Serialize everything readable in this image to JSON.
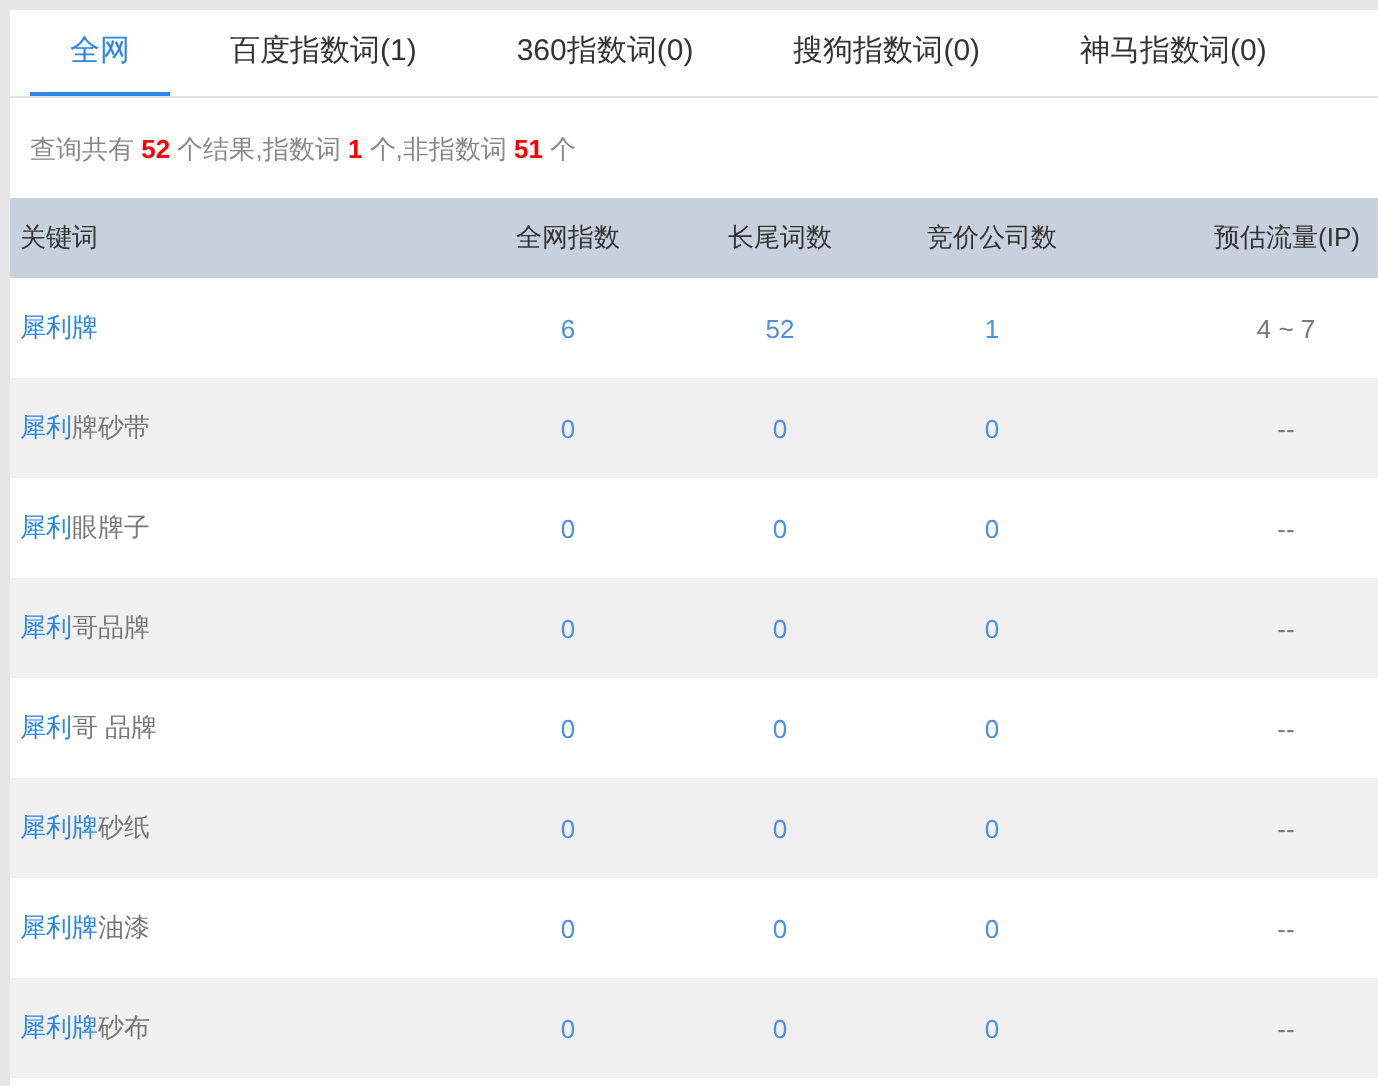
{
  "tabs": [
    {
      "label": "全网",
      "selected": true
    },
    {
      "label": "百度指数词(1)",
      "selected": false
    },
    {
      "label": "360指数词(0)",
      "selected": false
    },
    {
      "label": "搜狗指数词(0)",
      "selected": false
    },
    {
      "label": "神马指数词(0)",
      "selected": false
    }
  ],
  "summary": "查询共有 **52** 个结果,指数词 **1** 个,非指数词 **51** 个",
  "table": {
    "columns": [
      "关键词",
      "全网指数",
      "长尾词数",
      "竞价公司数",
      "预估流量(IP)"
    ],
    "rows": [
      {
        "keyword": {
          "match": "犀利牌"
        },
        "index": "6",
        "longtail": "52",
        "bidders": "1",
        "traffic": "4 ~ 7"
      },
      {
        "keyword": {
          "match": "犀利",
          "rest": "牌砂带"
        },
        "index": "0",
        "longtail": "0",
        "bidders": "0",
        "traffic": "--"
      },
      {
        "keyword": {
          "match": "犀利",
          "rest": "眼牌子"
        },
        "index": "0",
        "longtail": "0",
        "bidders": "0",
        "traffic": "--"
      },
      {
        "keyword": {
          "match": "犀利",
          "rest": "哥品牌"
        },
        "index": "0",
        "longtail": "0",
        "bidders": "0",
        "traffic": "--"
      },
      {
        "keyword": {
          "match": "犀利",
          "rest": "哥 品牌"
        },
        "index": "0",
        "longtail": "0",
        "bidders": "0",
        "traffic": "--"
      },
      {
        "keyword": {
          "match": "犀利牌",
          "rest": "砂纸"
        },
        "index": "0",
        "longtail": "0",
        "bidders": "0",
        "traffic": "--"
      },
      {
        "keyword": {
          "match": "犀利牌",
          "rest": "油漆"
        },
        "index": "0",
        "longtail": "0",
        "bidders": "0",
        "traffic": "--"
      },
      {
        "keyword": {
          "match": "犀利牌",
          "rest": "砂布"
        },
        "index": "0",
        "longtail": "0",
        "bidders": "0",
        "traffic": "--"
      }
    ]
  }
}
